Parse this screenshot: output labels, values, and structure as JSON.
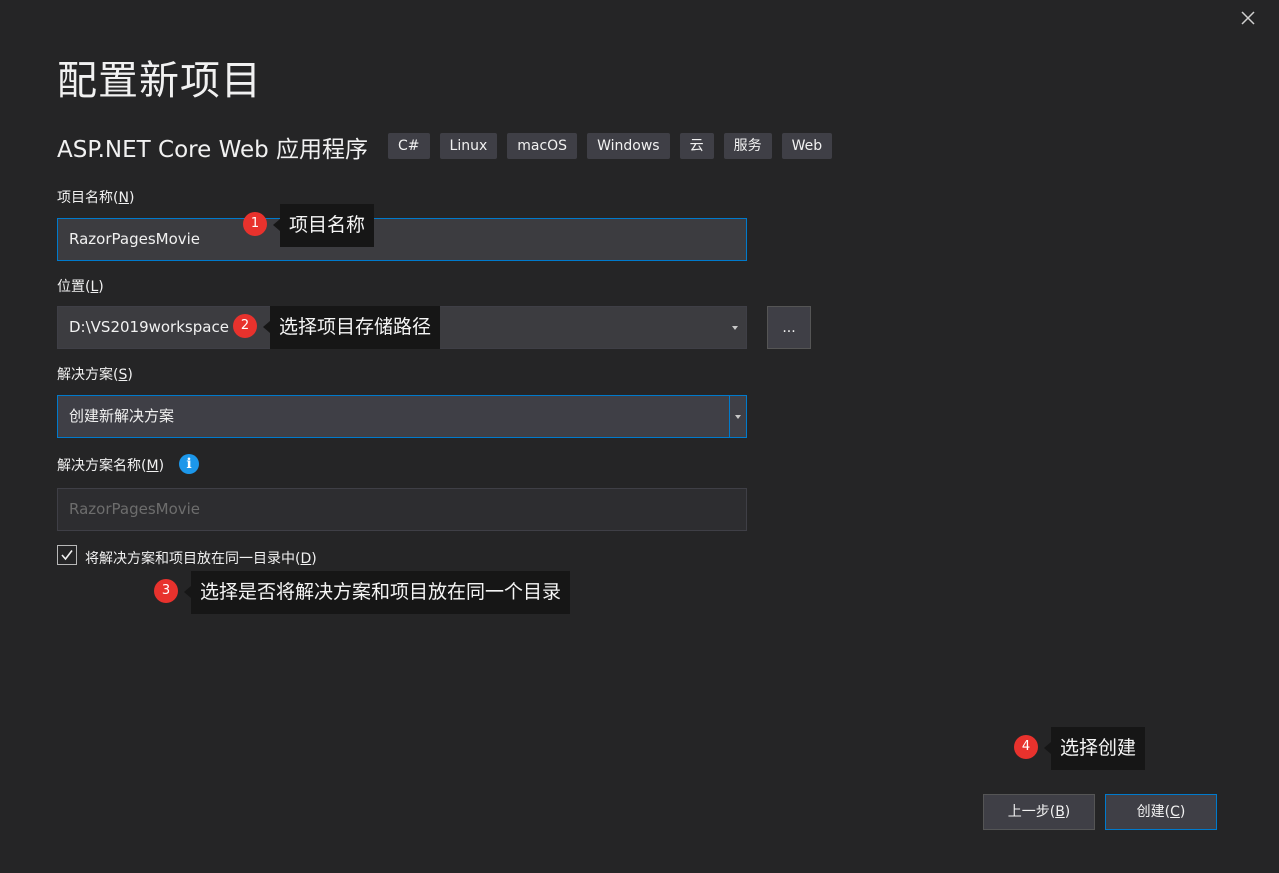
{
  "header": {
    "title": "配置新项目",
    "template_name": "ASP.NET Core Web 应用程序",
    "tags": [
      "C#",
      "Linux",
      "macOS",
      "Windows",
      "云",
      "服务",
      "Web"
    ]
  },
  "form": {
    "project_name": {
      "label": "项目名称(",
      "key": "N",
      "label_end": ")",
      "value": "RazorPagesMovie"
    },
    "location": {
      "label": "位置(",
      "key": "L",
      "label_end": ")",
      "value": "D:\\VS2019workspace",
      "browse_label": "..."
    },
    "solution": {
      "label": "解决方案(",
      "key": "S",
      "label_end": ")",
      "value": "创建新解决方案"
    },
    "solution_name": {
      "label": "解决方案名称(",
      "key": "M",
      "label_end": ")",
      "value": "RazorPagesMovie",
      "info_glyph": "i"
    },
    "same_directory": {
      "label": "将解决方案和项目放在同一目录中(",
      "key": "D",
      "label_end": ")",
      "checked": true
    }
  },
  "annotations": [
    {
      "number": "1",
      "text": "项目名称"
    },
    {
      "number": "2",
      "text": "选择项目存储路径"
    },
    {
      "number": "3",
      "text": "选择是否将解决方案和项目放在同一个目录"
    },
    {
      "number": "4",
      "text": "选择创建"
    }
  ],
  "footer": {
    "back": {
      "label": "上一步(",
      "key": "B",
      "label_end": ")"
    },
    "create": {
      "label": "创建(",
      "key": "C",
      "label_end": ")"
    }
  },
  "colors": {
    "background": "#252526",
    "accent": "#007acc",
    "badge": "#e8322d",
    "info": "#1c97ea"
  }
}
